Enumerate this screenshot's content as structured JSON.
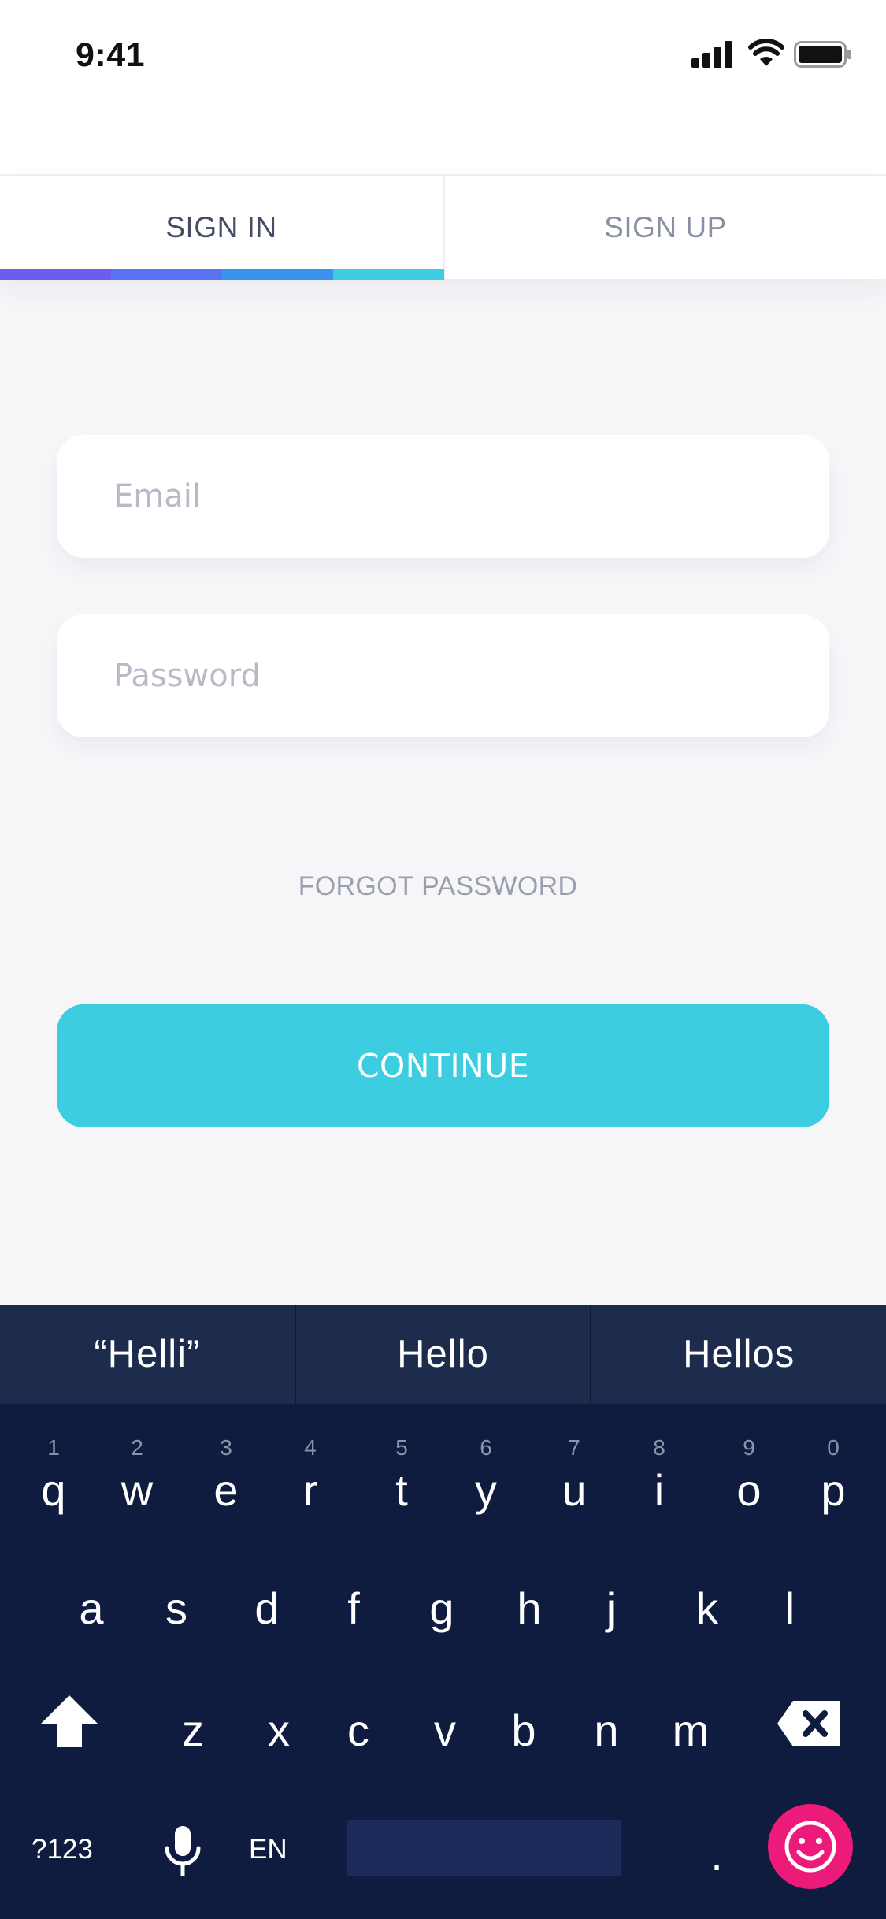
{
  "status_bar": {
    "time": "9:41",
    "icons": [
      "signal-bars-icon",
      "wifi-icon",
      "battery-icon"
    ]
  },
  "tabs": [
    {
      "label": "SIGN IN",
      "active": true
    },
    {
      "label": "SIGN UP",
      "active": false
    }
  ],
  "tab_indicator_colors": [
    "#6c5cf0",
    "#5b73f3",
    "#3a94ef",
    "#3ccde0"
  ],
  "form": {
    "email_placeholder": "Email",
    "email_value": "",
    "password_placeholder": "Password",
    "password_value": "",
    "forgot_password": "FORGOT PASSWORD",
    "continue": "CONTINUE"
  },
  "colors": {
    "accent": "#3ccde0",
    "background": "#f6f6f9",
    "keyboard_bg": "#0f1b3f",
    "suggestion_bg": "#1d2b4d",
    "emoji_button": "#ec1b7a"
  },
  "keyboard": {
    "suggestions": [
      "“Helli”",
      "Hello",
      "Hellos"
    ],
    "row1": [
      {
        "char": "q",
        "hint": "1"
      },
      {
        "char": "w",
        "hint": "2"
      },
      {
        "char": "e",
        "hint": "3"
      },
      {
        "char": "r",
        "hint": "4"
      },
      {
        "char": "t",
        "hint": "5"
      },
      {
        "char": "y",
        "hint": "6"
      },
      {
        "char": "u",
        "hint": "7"
      },
      {
        "char": "i",
        "hint": "8"
      },
      {
        "char": "o",
        "hint": "9"
      },
      {
        "char": "p",
        "hint": "0"
      }
    ],
    "row2": [
      "a",
      "s",
      "d",
      "f",
      "g",
      "h",
      "j",
      "k",
      "l"
    ],
    "row3": [
      "z",
      "x",
      "c",
      "v",
      "b",
      "n",
      "m"
    ],
    "mode_label": "?123",
    "language_label": "EN",
    "period": ".",
    "icons": [
      "shift-icon",
      "backspace-icon",
      "microphone-icon",
      "emoji-icon"
    ]
  }
}
